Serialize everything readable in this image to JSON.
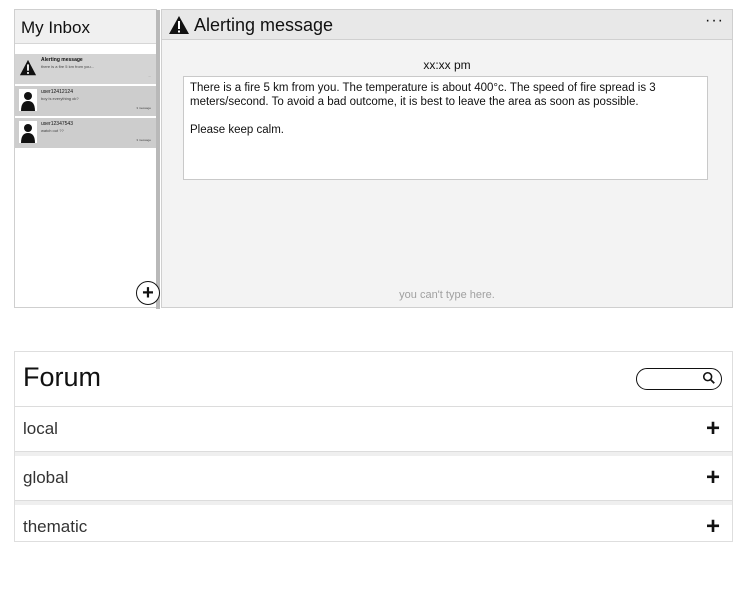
{
  "inbox": {
    "title": "My Inbox",
    "threads": [
      {
        "name": "Alerting message",
        "preview": "there is a fire 5 km from you...",
        "meta": "...",
        "icon": "warning-icon"
      },
      {
        "name": "user12412124",
        "preview": "boy is everything ok?",
        "meta": "3 message",
        "icon": "user-avatar-icon"
      },
      {
        "name": "user12347543",
        "preview": "watch out ??",
        "meta": "3 message",
        "icon": "user-avatar-icon"
      }
    ],
    "add_label": "+"
  },
  "message": {
    "title": "Alerting message",
    "more": "···",
    "time": "xx:xx pm",
    "body_1": "There is a fire 5 km from you. The temperature is about 400°c.  The speed of fire spread is 3 meters/second.  To avoid a bad outcome, it is best to leave the area as soon as possible.",
    "body_2": "Please keep calm.",
    "input_note": "you can't type here."
  },
  "forum": {
    "title": "Forum",
    "search_icon": "search-icon",
    "rows": [
      {
        "label": "local",
        "action": "+"
      },
      {
        "label": "global",
        "action": "+"
      },
      {
        "label": "thematic",
        "action": "+"
      }
    ]
  }
}
